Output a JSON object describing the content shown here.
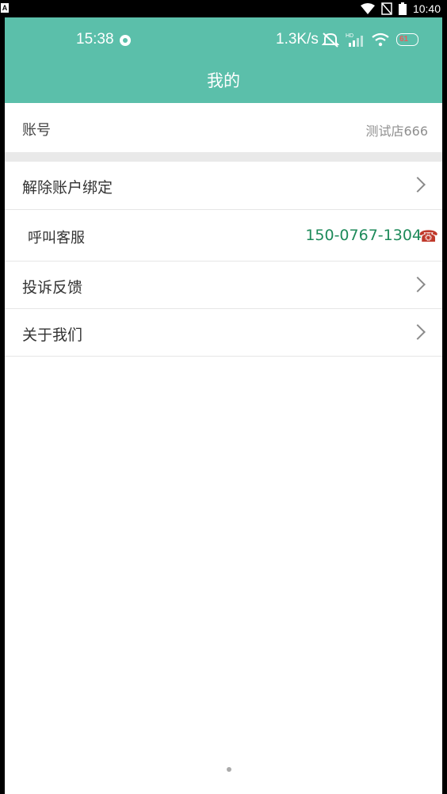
{
  "system_status": {
    "badge": "A",
    "time": "10:40",
    "icons": [
      "wifi-icon",
      "no-sim-icon",
      "battery-icon"
    ]
  },
  "inner_status": {
    "time": "15:38",
    "speed": "1.3K/s",
    "icons": [
      "mute-icon",
      "hd-signal-icon",
      "wifi-icon",
      "battery-icon"
    ],
    "battery_text": "61"
  },
  "header": {
    "title": "我的"
  },
  "account": {
    "label": "账号",
    "value": "测试店666"
  },
  "menu": {
    "unbind_label": "解除账户绑定",
    "service_label": "呼叫客服",
    "service_phone": "150-0767-1304",
    "complaint_label": "投诉反馈",
    "about_label": "关于我们"
  },
  "colors": {
    "header_bg": "#5bbfaa",
    "phone_text": "#1e8a5a",
    "phone_icon": "#c0392b"
  }
}
